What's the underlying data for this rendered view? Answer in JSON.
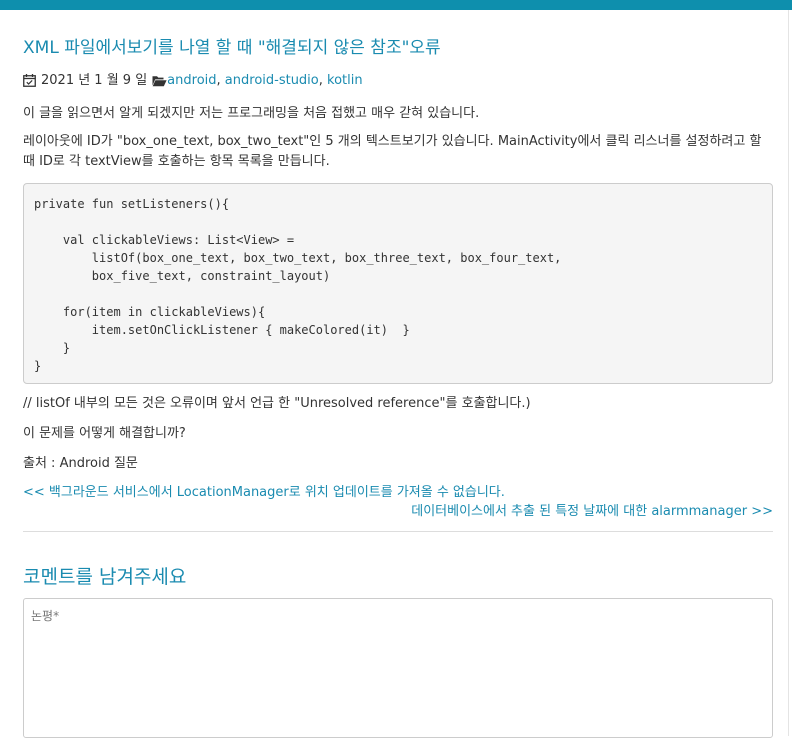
{
  "colors": {
    "accent": "#1a8bb0",
    "top_bar": "#0e8fad"
  },
  "post": {
    "title": "XML 파일에서보기를 나열 할 때 \"해결되지 않은 참조\"오류",
    "date": "2021 년 1 월 9 일",
    "tags": [
      {
        "label": "android"
      },
      {
        "label": "android-studio"
      },
      {
        "label": "kotlin"
      }
    ],
    "tag_separator": ",",
    "paragraphs": {
      "p1": "이 글을 읽으면서 알게 되겠지만 저는 프로그래밍을 처음 접했고 매우 갇혀 있습니다.",
      "p2": "레이아웃에 ID가 \"box_one_text, box_two_text\"인 5 개의 텍스트보기가 있습니다. MainActivity에서 클릭 리스너를 설정하려고 할 때 ID로 각 textView를 호출하는 항목 목록을 만듭니다.",
      "p3": "// listOf 내부의 모든 것은 오류이며 앞서 언급 한 \"Unresolved reference\"를 호출합니다.)",
      "p4": "이 문제를 어떻게 해결합니까?",
      "p5": "출처 : Android 질문"
    },
    "code": "private fun setListeners(){\n\n    val clickableViews: List<View> =\n        listOf(box_one_text, box_two_text, box_three_text, box_four_text,\n        box_five_text, constraint_layout)\n\n    for(item in clickableViews){\n        item.setOnClickListener { makeColored(it)  }\n    }\n}"
  },
  "navigation": {
    "prev": "<< 백그라운드 서비스에서 LocationManager로 위치 업데이트를 가져올 수 없습니다.",
    "next": "데이터베이스에서 추출 된 특정 날짜에 대한 alarmmanager >>"
  },
  "comments": {
    "heading": "코멘트를 남겨주세요",
    "placeholder": "논평*"
  },
  "icons": {
    "date": "calendar-icon",
    "tags": "folder-open-icon"
  }
}
